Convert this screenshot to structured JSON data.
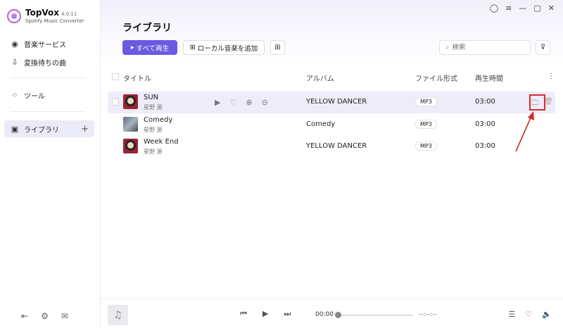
{
  "app": {
    "name": "TopVox",
    "version": "4.0.11",
    "subtitle": "Spotify Music Converter"
  },
  "sidebar": {
    "items": [
      {
        "label": "音楽サービス",
        "icon": "music-disc-icon"
      },
      {
        "label": "変換待ちの曲",
        "icon": "download-tray-icon"
      },
      {
        "label": "ツール",
        "icon": "tools-grid-icon"
      },
      {
        "label": "ライブラリ",
        "icon": "library-icon",
        "active": true
      }
    ],
    "add_symbol": "+"
  },
  "main": {
    "title": "ライブラリ",
    "play_all_label": "すべて再生",
    "add_local_label": "ローカル音楽を追加",
    "search_placeholder": "検索"
  },
  "table": {
    "headers": {
      "title": "タイトル",
      "album": "アルバム",
      "format": "ファイル形式",
      "duration": "再生時間"
    },
    "rows": [
      {
        "title": "SUN",
        "artist": "星野 源",
        "album": "YELLOW DANCER",
        "format": "MP3",
        "duration": "03:00",
        "selected": true
      },
      {
        "title": "Comedy",
        "artist": "星野 源",
        "album": "Comedy",
        "format": "MP3",
        "duration": "03:00"
      },
      {
        "title": "Week End",
        "artist": "星野 源",
        "album": "YELLOW DANCER",
        "format": "MP3",
        "duration": "03:00"
      }
    ]
  },
  "player": {
    "current_time": "00:00",
    "total_time": "--:--:--"
  },
  "colors": {
    "accent": "#6a5ae0",
    "highlight": "#d32d2d",
    "selected_row": "#eeecf9"
  }
}
